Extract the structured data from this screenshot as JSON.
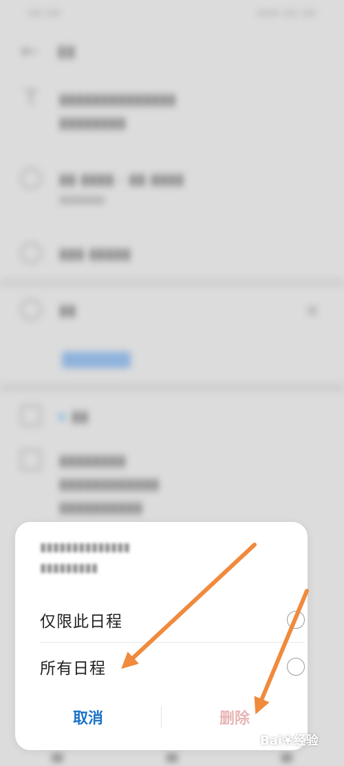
{
  "background_app": {
    "note": "blurred, illegible background screen"
  },
  "dialog": {
    "options": [
      {
        "label": "仅限此日程",
        "selected": false
      },
      {
        "label": "所有日程",
        "selected": false
      }
    ],
    "cancel_label": "取消",
    "delete_label": "删除"
  },
  "colors": {
    "cancel": "#1a73c8",
    "delete": "#e7b5b5",
    "arrow": "#f08a3c"
  }
}
